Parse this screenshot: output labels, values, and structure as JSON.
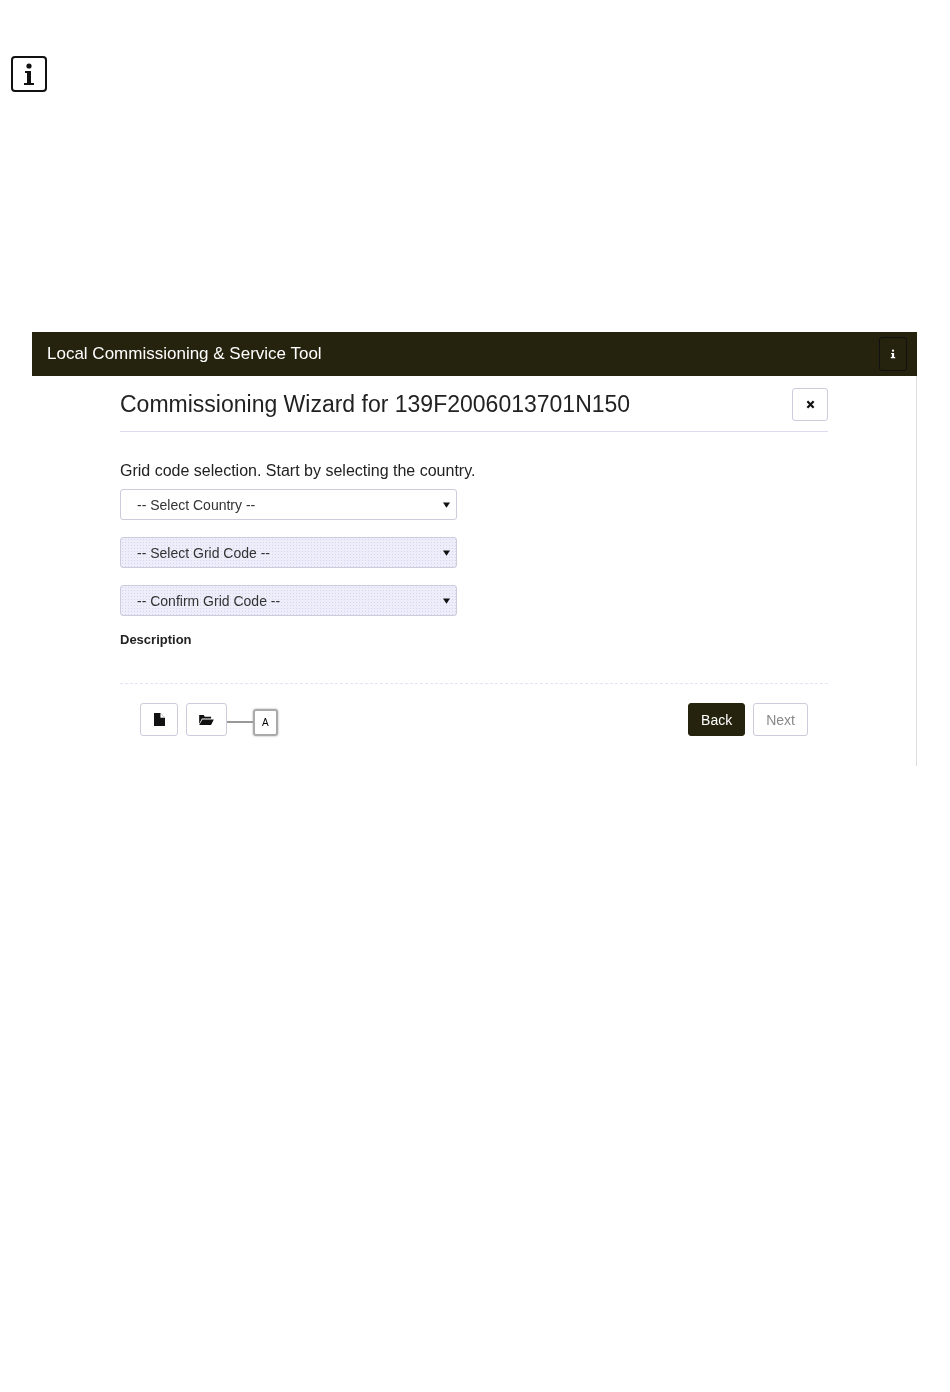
{
  "app_bar": {
    "title": "Local Commissioning & Service Tool"
  },
  "wizard": {
    "title": "Commissioning Wizard for 139F2006013701N150",
    "instruction": "Grid code selection. Start by selecting the country.",
    "selects": [
      {
        "placeholder": "-- Select Country --",
        "disabled": false
      },
      {
        "placeholder": "-- Select Grid Code --",
        "disabled": true
      },
      {
        "placeholder": "-- Confirm Grid Code --",
        "disabled": true
      }
    ],
    "description_label": "Description",
    "callout": "A",
    "buttons": [
      {
        "label": "Back",
        "kind": "primary",
        "disabled": false
      },
      {
        "label": "Next",
        "kind": "default",
        "disabled": true
      }
    ]
  }
}
